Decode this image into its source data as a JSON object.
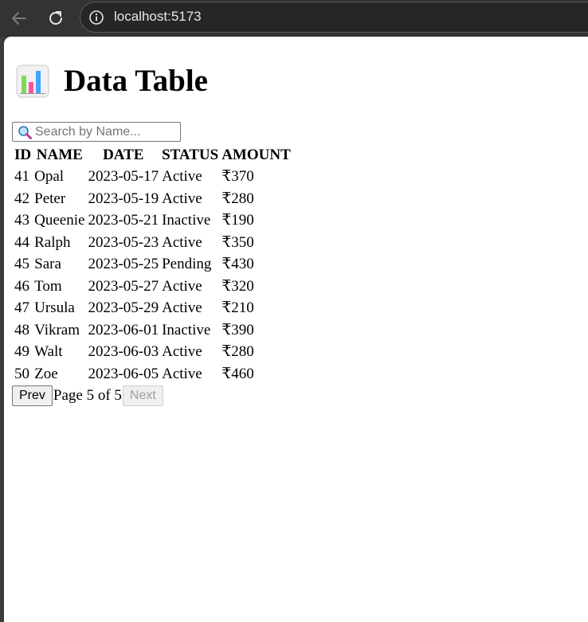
{
  "browser": {
    "url": "localhost:5173"
  },
  "page": {
    "title": "Data Table"
  },
  "search": {
    "placeholder": "Search by Name...",
    "value": ""
  },
  "table": {
    "columns": [
      "ID",
      "NAME",
      "DATE",
      "STATUS",
      "AMOUNT"
    ],
    "rows": [
      {
        "id": "41",
        "name": "Opal",
        "date": "2023-05-17",
        "status": "Active",
        "amount": "₹370"
      },
      {
        "id": "42",
        "name": "Peter",
        "date": "2023-05-19",
        "status": "Active",
        "amount": "₹280"
      },
      {
        "id": "43",
        "name": "Queenie",
        "date": "2023-05-21",
        "status": "Inactive",
        "amount": "₹190"
      },
      {
        "id": "44",
        "name": "Ralph",
        "date": "2023-05-23",
        "status": "Active",
        "amount": "₹350"
      },
      {
        "id": "45",
        "name": "Sara",
        "date": "2023-05-25",
        "status": "Pending",
        "amount": "₹430"
      },
      {
        "id": "46",
        "name": "Tom",
        "date": "2023-05-27",
        "status": "Active",
        "amount": "₹320"
      },
      {
        "id": "47",
        "name": "Ursula",
        "date": "2023-05-29",
        "status": "Active",
        "amount": "₹210"
      },
      {
        "id": "48",
        "name": "Vikram",
        "date": "2023-06-01",
        "status": "Inactive",
        "amount": "₹390"
      },
      {
        "id": "49",
        "name": "Walt",
        "date": "2023-06-03",
        "status": "Active",
        "amount": "₹280"
      },
      {
        "id": "50",
        "name": "Zoe",
        "date": "2023-06-05",
        "status": "Active",
        "amount": "₹460"
      }
    ]
  },
  "pagination": {
    "prev_label": "Prev",
    "page_text": "Page 5 of 5",
    "next_label": "Next",
    "current_page": 5,
    "total_pages": 5
  },
  "icons": {
    "back": "arrow-left-icon",
    "reload": "reload-icon",
    "info": "info-circle-icon",
    "title": "bar-chart-emoji-icon",
    "search": "magnifying-glass-icon"
  },
  "colors": {
    "toolbar_bg": "#333333",
    "page_bg": "#ffffff",
    "disabled_text": "#a0a0a0"
  }
}
